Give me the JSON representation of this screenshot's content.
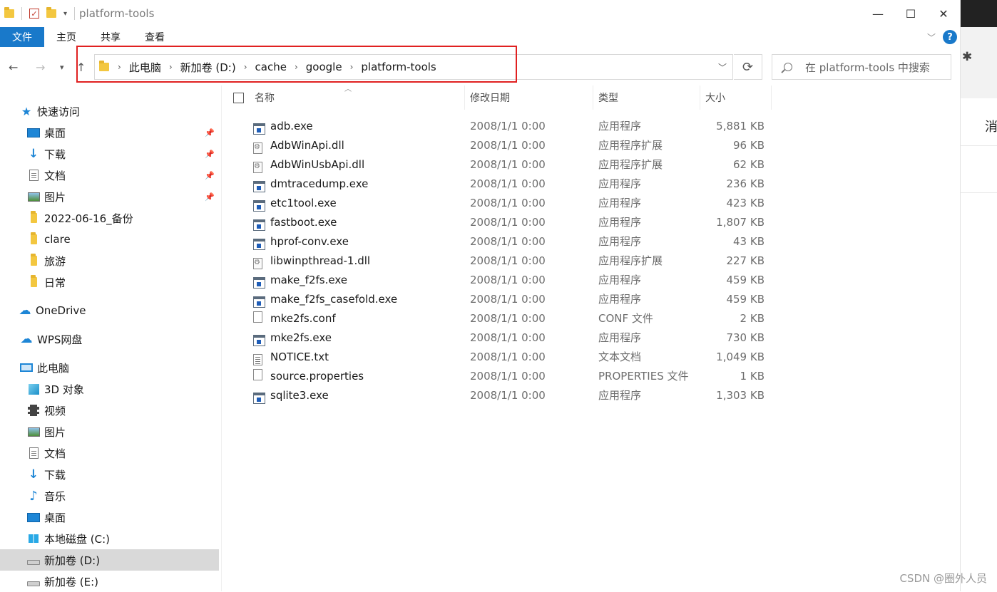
{
  "window": {
    "title": "platform-tools"
  },
  "ribbon": {
    "tabs": [
      "文件",
      "主页",
      "共享",
      "查看"
    ]
  },
  "address": {
    "breadcrumbs": [
      "此电脑",
      "新加卷 (D:)",
      "cache",
      "google",
      "platform-tools"
    ]
  },
  "search": {
    "placeholder": "在 platform-tools 中搜索"
  },
  "sidebar": {
    "items": [
      {
        "label": "快速访问",
        "icon": "star-icon"
      },
      {
        "label": "桌面",
        "icon": "desktop-icon",
        "pinned": true
      },
      {
        "label": "下载",
        "icon": "download-icon",
        "pinned": true
      },
      {
        "label": "文档",
        "icon": "document-icon",
        "pinned": true
      },
      {
        "label": "图片",
        "icon": "picture-icon",
        "pinned": true
      },
      {
        "label": "2022-06-16_备份",
        "icon": "folder-icon"
      },
      {
        "label": "clare",
        "icon": "folder-icon"
      },
      {
        "label": "旅游",
        "icon": "folder-icon"
      },
      {
        "label": "日常",
        "icon": "folder-icon"
      },
      {
        "label": "OneDrive",
        "icon": "cloud-icon"
      },
      {
        "label": "WPS网盘",
        "icon": "cloud-icon"
      },
      {
        "label": "此电脑",
        "icon": "pc-icon"
      },
      {
        "label": "3D 对象",
        "icon": "3d-objects-icon"
      },
      {
        "label": "视频",
        "icon": "video-icon"
      },
      {
        "label": "图片",
        "icon": "picture-icon"
      },
      {
        "label": "文档",
        "icon": "document-icon"
      },
      {
        "label": "下载",
        "icon": "download-icon"
      },
      {
        "label": "音乐",
        "icon": "music-icon"
      },
      {
        "label": "桌面",
        "icon": "desktop-icon"
      },
      {
        "label": "本地磁盘 (C:)",
        "icon": "windows-drive-icon"
      },
      {
        "label": "新加卷 (D:)",
        "icon": "drive-icon",
        "selected": true
      },
      {
        "label": "新加卷 (E:)",
        "icon": "drive-icon"
      }
    ]
  },
  "columns": {
    "name": "名称",
    "date": "修改日期",
    "type": "类型",
    "size": "大小"
  },
  "files": [
    {
      "name": "adb.exe",
      "date": "2008/1/1 0:00",
      "type": "应用程序",
      "size": "5,881 KB",
      "icon": "exe"
    },
    {
      "name": "AdbWinApi.dll",
      "date": "2008/1/1 0:00",
      "type": "应用程序扩展",
      "size": "96 KB",
      "icon": "dll"
    },
    {
      "name": "AdbWinUsbApi.dll",
      "date": "2008/1/1 0:00",
      "type": "应用程序扩展",
      "size": "62 KB",
      "icon": "dll"
    },
    {
      "name": "dmtracedump.exe",
      "date": "2008/1/1 0:00",
      "type": "应用程序",
      "size": "236 KB",
      "icon": "exe"
    },
    {
      "name": "etc1tool.exe",
      "date": "2008/1/1 0:00",
      "type": "应用程序",
      "size": "423 KB",
      "icon": "exe"
    },
    {
      "name": "fastboot.exe",
      "date": "2008/1/1 0:00",
      "type": "应用程序",
      "size": "1,807 KB",
      "icon": "exe"
    },
    {
      "name": "hprof-conv.exe",
      "date": "2008/1/1 0:00",
      "type": "应用程序",
      "size": "43 KB",
      "icon": "exe"
    },
    {
      "name": "libwinpthread-1.dll",
      "date": "2008/1/1 0:00",
      "type": "应用程序扩展",
      "size": "227 KB",
      "icon": "dll"
    },
    {
      "name": "make_f2fs.exe",
      "date": "2008/1/1 0:00",
      "type": "应用程序",
      "size": "459 KB",
      "icon": "exe"
    },
    {
      "name": "make_f2fs_casefold.exe",
      "date": "2008/1/1 0:00",
      "type": "应用程序",
      "size": "459 KB",
      "icon": "exe"
    },
    {
      "name": "mke2fs.conf",
      "date": "2008/1/1 0:00",
      "type": "CONF 文件",
      "size": "2 KB",
      "icon": "file"
    },
    {
      "name": "mke2fs.exe",
      "date": "2008/1/1 0:00",
      "type": "应用程序",
      "size": "730 KB",
      "icon": "exe"
    },
    {
      "name": "NOTICE.txt",
      "date": "2008/1/1 0:00",
      "type": "文本文档",
      "size": "1,049 KB",
      "icon": "txt"
    },
    {
      "name": "source.properties",
      "date": "2008/1/1 0:00",
      "type": "PROPERTIES 文件",
      "size": "1 KB",
      "icon": "file"
    },
    {
      "name": "sqlite3.exe",
      "date": "2008/1/1 0:00",
      "type": "应用程序",
      "size": "1,303 KB",
      "icon": "exe"
    }
  ],
  "side_app": {
    "text": "消"
  },
  "watermark": "CSDN @圈外人员",
  "colors": {
    "accent": "#1979ca",
    "highlight_box": "#e02020",
    "selection": "#d9d9d9"
  }
}
